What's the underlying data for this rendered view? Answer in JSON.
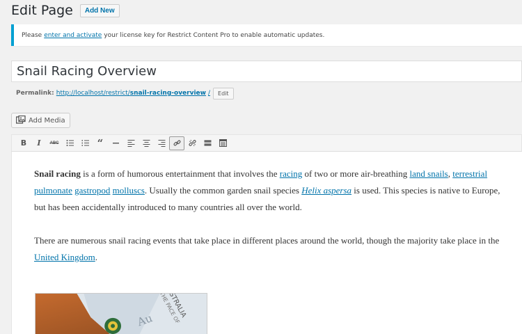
{
  "header": {
    "title": "Edit Page",
    "add_new": "Add New"
  },
  "notice": {
    "before": "Please",
    "link": "enter and activate",
    "after": "your license key for Restrict Content Pro to enable automatic updates."
  },
  "title_field": {
    "value": "Snail Racing Overview"
  },
  "permalink": {
    "label": "Permalink:",
    "url_base": "http://localhost/restrict/",
    "slug": "snail-racing-overview",
    "url_end": "/",
    "edit": "Edit"
  },
  "add_media": {
    "label": "Add Media"
  },
  "toolbar": {
    "icons": [
      "bold-icon",
      "italic-icon",
      "strikethrough-icon",
      "bullet-list-icon",
      "numbered-list-icon",
      "blockquote-icon",
      "horizontal-line-icon",
      "align-left-icon",
      "align-center-icon",
      "align-right-icon",
      "insert-link-icon",
      "remove-link-icon",
      "read-more-icon",
      "toolbar-toggle-icon"
    ]
  },
  "content": {
    "p1": {
      "bold": "Snail racing",
      "t1": " is a form of humorous entertainment that involves the ",
      "l1": "racing",
      "t2": " of two or more air-breathing ",
      "l2": "land snails",
      "t3": ", ",
      "l3": "terrestrial",
      "t4": " ",
      "l4": "pulmonate",
      "t5": " ",
      "l5": "gastropod",
      "t6": " ",
      "l6": "molluscs",
      "t7": ". Usually the common garden snail species ",
      "l7": "Helix aspersa",
      "t8": " is used. This species is native to Europe, but has been accidentally introduced to many countries all over the world."
    },
    "p2": {
      "t1": "There are numerous snail racing events that take place in different places around the world, though the majority take place in the ",
      "l1": "United Kingdom",
      "t2": "."
    }
  },
  "photo": {
    "stamp_text": "AUSTRALIA",
    "stamp_sub": "THE PACE OF",
    "scrawl": "Au"
  }
}
